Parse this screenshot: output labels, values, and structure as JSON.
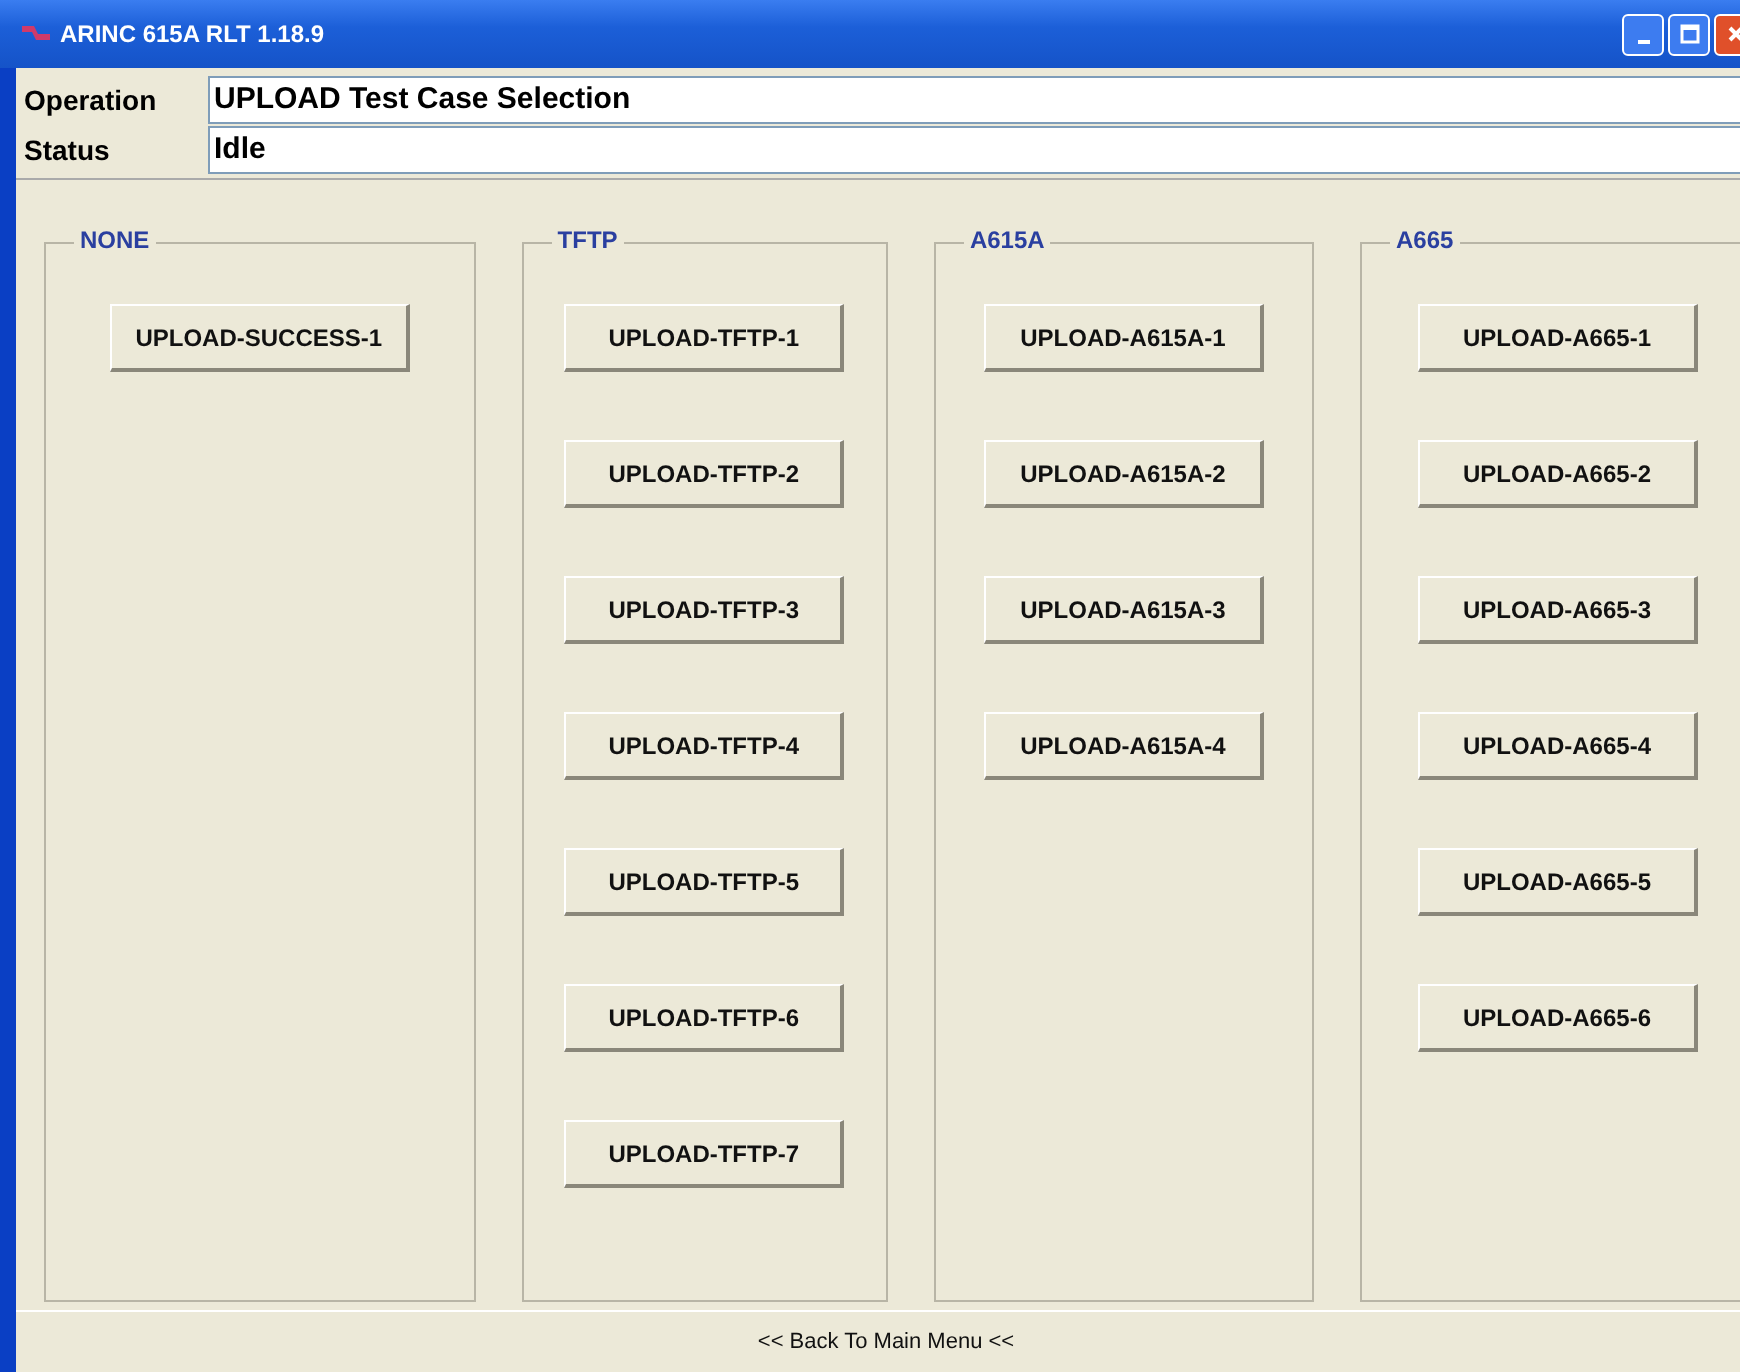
{
  "window": {
    "title": "ARINC 615A RLT 1.18.9"
  },
  "fields": [
    {
      "label": "Operation",
      "value": "UPLOAD Test Case Selection"
    },
    {
      "label": "Status",
      "value": "Idle"
    }
  ],
  "groups": [
    {
      "title": "NONE",
      "buttons": [
        "UPLOAD-SUCCESS-1"
      ]
    },
    {
      "title": "TFTP",
      "buttons": [
        "UPLOAD-TFTP-1",
        "UPLOAD-TFTP-2",
        "UPLOAD-TFTP-3",
        "UPLOAD-TFTP-4",
        "UPLOAD-TFTP-5",
        "UPLOAD-TFTP-6",
        "UPLOAD-TFTP-7"
      ]
    },
    {
      "title": "A615A",
      "buttons": [
        "UPLOAD-A615A-1",
        "UPLOAD-A615A-2",
        "UPLOAD-A615A-3",
        "UPLOAD-A615A-4"
      ]
    },
    {
      "title": "A665",
      "buttons": [
        "UPLOAD-A665-1",
        "UPLOAD-A665-2",
        "UPLOAD-A665-3",
        "UPLOAD-A665-4",
        "UPLOAD-A665-5",
        "UPLOAD-A665-6"
      ]
    }
  ],
  "footer": {
    "link": "<< Back To Main Menu <<"
  }
}
